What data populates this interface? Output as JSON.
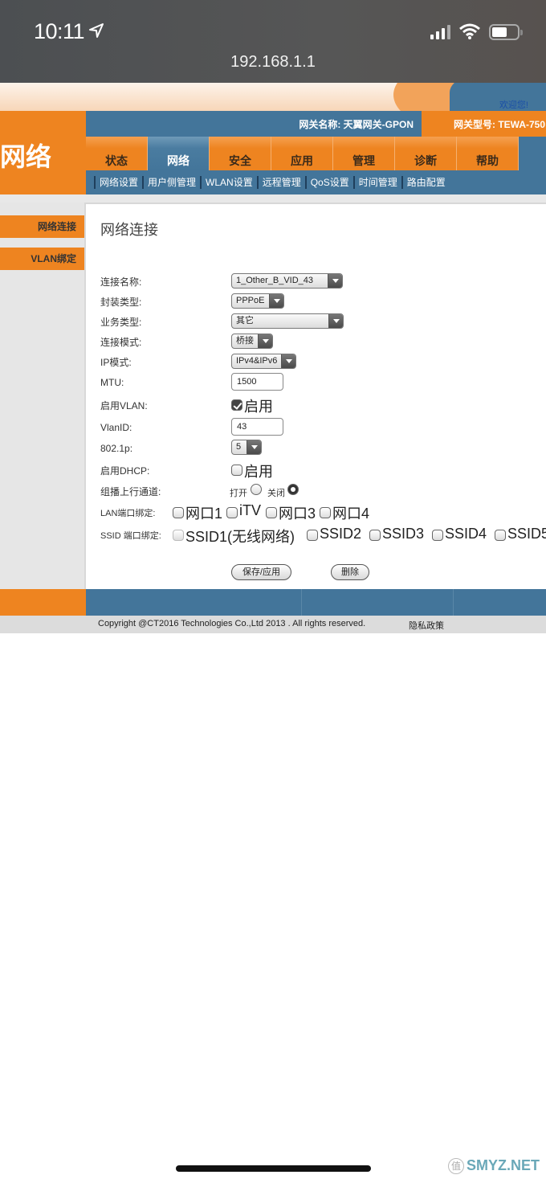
{
  "status_bar": {
    "time": "10:11",
    "url": "192.168.1.1"
  },
  "header": {
    "welcome": "欢迎您!",
    "section_title": "网络",
    "gateway_name": "网关名称:  天翼网关-GPON",
    "gateway_model": "网关型号:  TEWA-750"
  },
  "tabs": [
    {
      "label": "状态",
      "active": false
    },
    {
      "label": "网络",
      "active": true
    },
    {
      "label": "安全",
      "active": false
    },
    {
      "label": "应用",
      "active": false
    },
    {
      "label": "管理",
      "active": false
    },
    {
      "label": "诊断",
      "active": false
    },
    {
      "label": "帮助",
      "active": false
    }
  ],
  "subnav": [
    "网络设置",
    "用户侧管理",
    "WLAN设置",
    "远程管理",
    "QoS设置",
    "时间管理",
    "路由配置"
  ],
  "sidebar": {
    "items": [
      "网络连接",
      "VLAN绑定"
    ]
  },
  "form": {
    "heading": "网络连接",
    "connection_name": {
      "label": "连接名称:",
      "value": "1_Other_B_VID_43"
    },
    "encapsulation": {
      "label": "封装类型:",
      "value": "PPPoE"
    },
    "service_type": {
      "label": "业务类型:",
      "value": "其它"
    },
    "connection_mode": {
      "label": "连接模式:",
      "value": "桥接"
    },
    "ip_mode": {
      "label": "IP模式:",
      "value": "IPv4&IPv6"
    },
    "mtu": {
      "label": "MTU:",
      "value": "1500"
    },
    "enable_vlan": {
      "label": "启用VLAN:",
      "option": "启用",
      "checked": true
    },
    "vlan_id": {
      "label": "VlanID:",
      "value": "43"
    },
    "dot1p": {
      "label": "802.1p:",
      "value": "5"
    },
    "enable_dhcp": {
      "label": "启用DHCP:",
      "option": "启用",
      "checked": false
    },
    "multicast_upstream": {
      "label": "组播上行通道:",
      "on_label": "打开",
      "off_label": "关闭",
      "selected": "off"
    },
    "lan_binding": {
      "label": "LAN端口绑定:",
      "ports": [
        "网口1",
        "iTV",
        "网口3",
        "网口4"
      ]
    },
    "ssid_binding": {
      "label": "SSID 端口绑定:",
      "ssids": [
        "SSID1(无线网络)",
        "SSID2",
        "SSID3",
        "SSID4",
        "SSID5"
      ]
    },
    "save_button": "保存/应用",
    "delete_button": "删除"
  },
  "footer": {
    "copyright": "Copyright @CT2016 Technologies Co.,Ltd 2013 . All rights reserved.",
    "privacy": "隐私政策"
  },
  "watermark": {
    "seal": "值",
    "text": "SMYZ.NET"
  }
}
